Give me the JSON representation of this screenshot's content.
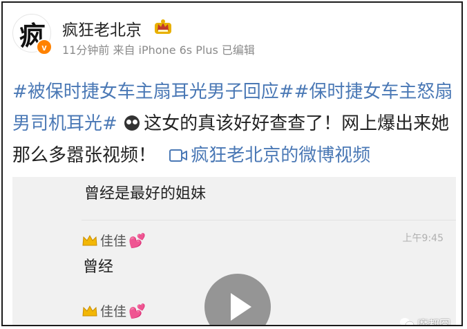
{
  "post": {
    "avatar_text": "疯",
    "verified_mark": "v",
    "username": "疯狂老北京",
    "meta": "11分钟前 来自 iPhone 6s Plus 已编辑",
    "topic1": "#被保时捷女车主扇耳光男子回应#",
    "topic2": "#保时捷女车主怒扇男司机耳光#",
    "body_text": "这女的真该好好查查了！网上爆出来她那么多嚣张视频！",
    "video_link": "疯狂老北京的微博视频"
  },
  "video": {
    "chat_title": "曾经是最好的姐妹",
    "message1_sender": "佳佳",
    "message1_time": "上午9:45",
    "message1_text": "曾经",
    "message2_sender": "佳佳",
    "watermark": "魔都囧"
  },
  "colors": {
    "link": "#4a78b5",
    "verified": "#ff8200",
    "vip": "#e8b000"
  },
  "icons": [
    "vip-crown-icon",
    "emoji-icon",
    "video-icon",
    "play-icon",
    "crown-icon",
    "heart-icon",
    "wechat-icon"
  ]
}
